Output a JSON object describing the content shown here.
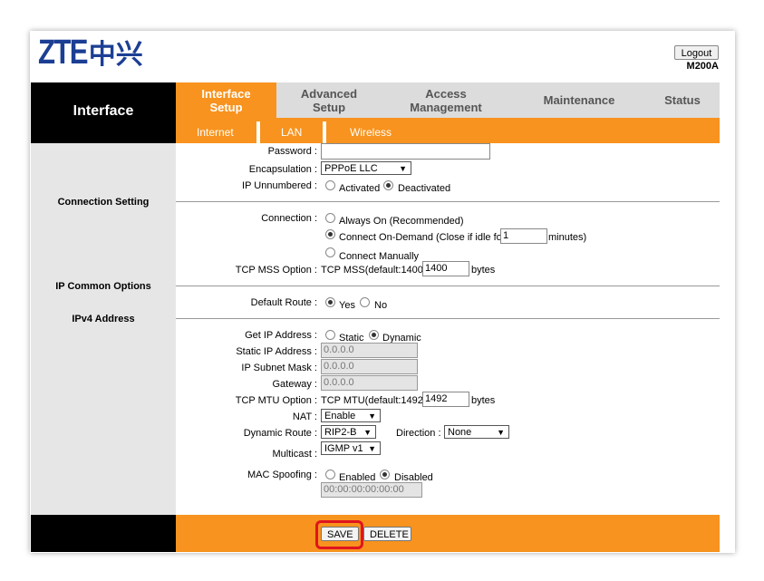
{
  "brand": {
    "latin": "ZTE",
    "cjk": "中兴",
    "model": "M200A",
    "logout_label": "Logout"
  },
  "nav": {
    "section_title": "Interface",
    "tabs": [
      {
        "line1": "Interface",
        "line2": "Setup"
      },
      {
        "line1": "Advanced",
        "line2": "Setup"
      },
      {
        "line1": "Access",
        "line2": "Management"
      },
      {
        "line1": "Maintenance",
        "line2": ""
      },
      {
        "line1": "Status",
        "line2": ""
      }
    ],
    "subtabs": [
      "Internet",
      "LAN",
      "Wireless"
    ]
  },
  "sections": {
    "connection_setting": "Connection Setting",
    "ip_common_options": "IP Common Options",
    "ipv4_address": "IPv4 Address"
  },
  "form": {
    "password_label": "Password :",
    "encapsulation_label": "Encapsulation :",
    "encapsulation_value": "PPPoE LLC",
    "ip_unnumbered_label": "IP Unnumbered :",
    "activated": "Activated",
    "deactivated": "Deactivated",
    "connection_label": "Connection :",
    "always_on": "Always On (Recommended)",
    "connect_on_demand": "Connect On-Demand (Close if idle for",
    "idle_value": "1",
    "minutes": "minutes)",
    "connect_manually": "Connect Manually",
    "tcp_mss_label": "TCP MSS Option :",
    "tcp_mss_text": "TCP MSS(default:1400)",
    "tcp_mss_value": "1400",
    "bytes": "bytes",
    "default_route_label": "Default Route :",
    "yes": "Yes",
    "no": "No",
    "get_ip_label": "Get IP Address :",
    "static": "Static",
    "dynamic": "Dynamic",
    "static_ip_label": "Static IP Address :",
    "static_ip_value": "0.0.0.0",
    "subnet_label": "IP Subnet Mask :",
    "subnet_value": "0.0.0.0",
    "gateway_label": "Gateway :",
    "gateway_value": "0.0.0.0",
    "tcp_mtu_label": "TCP MTU Option :",
    "tcp_mtu_text": "TCP MTU(default:1492)",
    "tcp_mtu_value": "1492",
    "nat_label": "NAT :",
    "nat_value": "Enable",
    "dynamic_route_label": "Dynamic Route :",
    "dynamic_route_value": "RIP2-B",
    "direction_label": "Direction :",
    "direction_value": "None",
    "multicast_label": "Multicast :",
    "multicast_value": "IGMP v1",
    "mac_spoofing_label": "MAC Spoofing :",
    "enabled": "Enabled",
    "disabled": "Disabled",
    "mac_value": "00:00:00:00:00:00"
  },
  "buttons": {
    "save": "SAVE",
    "delete": "DELETE"
  },
  "colors": {
    "accent": "#f7931e",
    "brand": "#1c3f94",
    "highlight": "#e0141e"
  }
}
